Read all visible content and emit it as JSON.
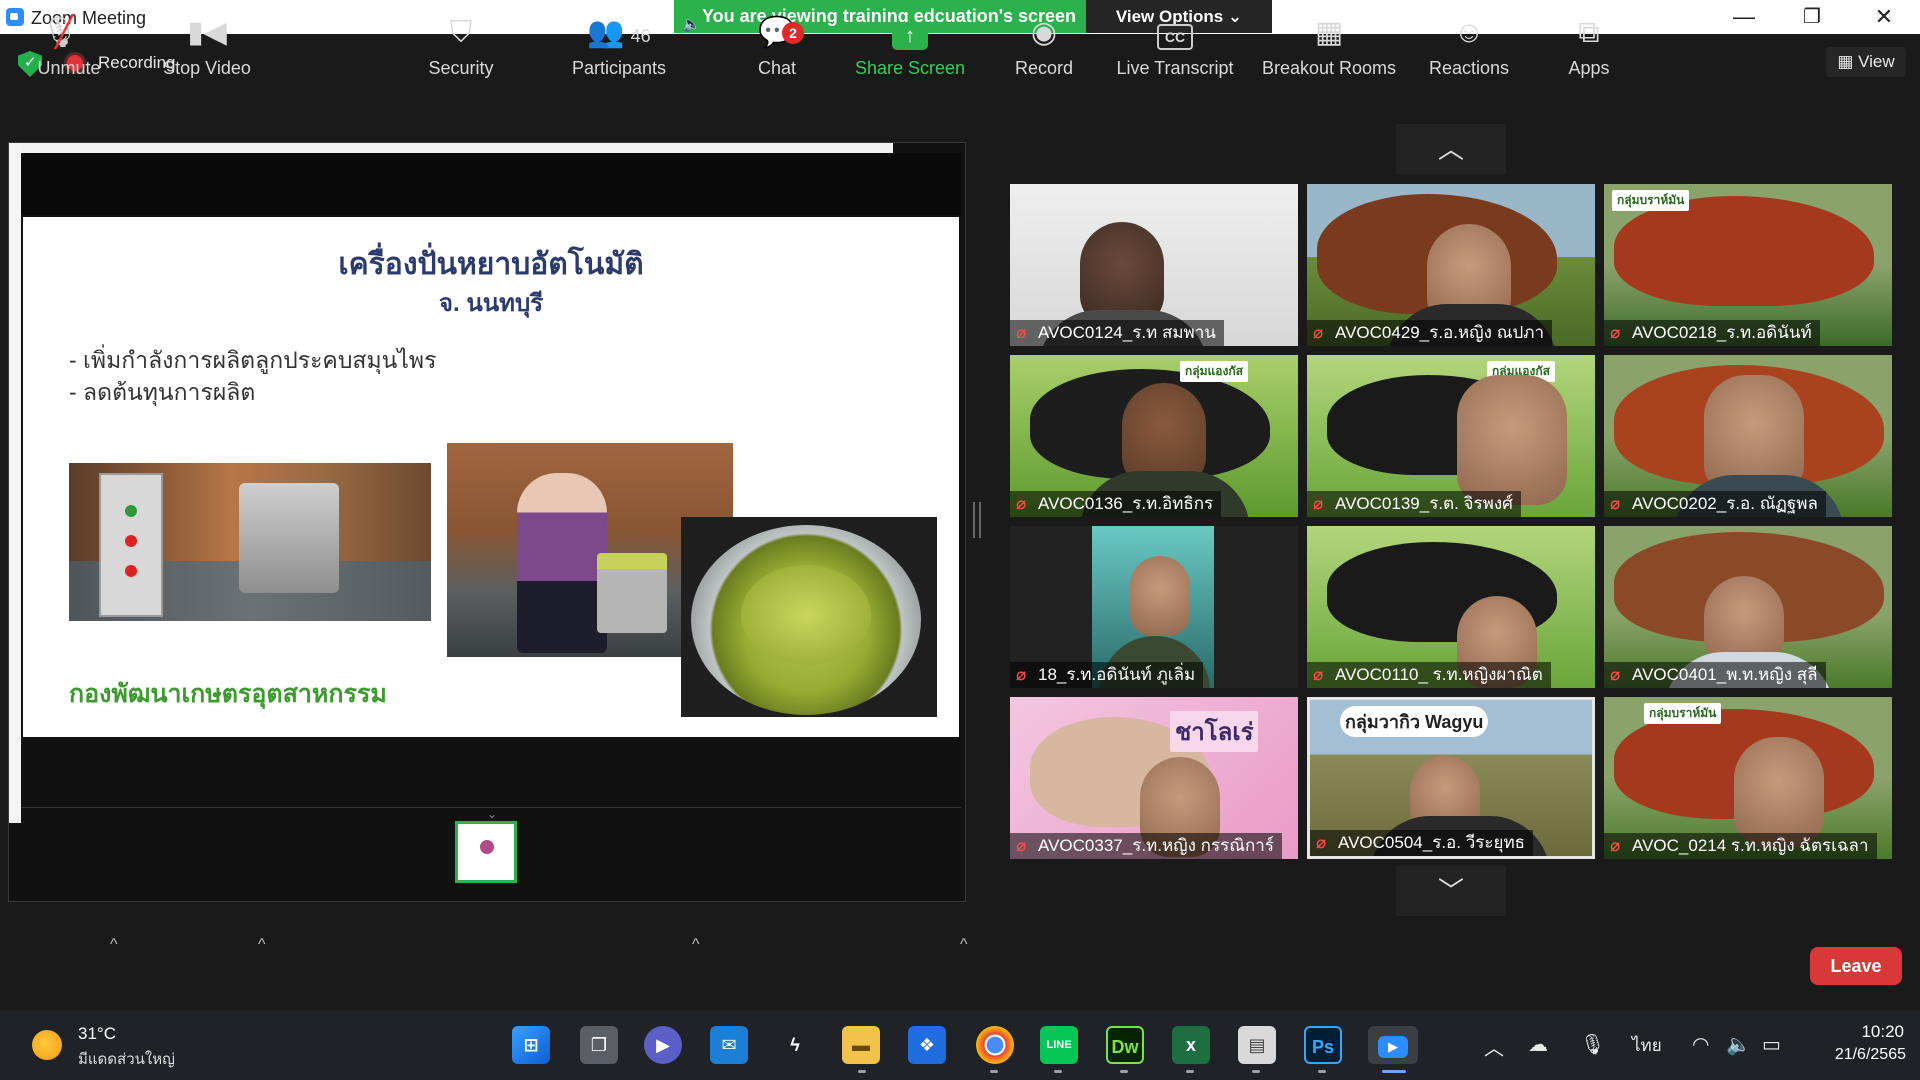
{
  "window": {
    "title": "Zoom Meeting"
  },
  "share_banner": {
    "text": "You are viewing training edcuation's screen",
    "view_options": "View Options ⌄"
  },
  "status": {
    "recording_label": "Recording",
    "view_label": "View"
  },
  "slide": {
    "title": "เครื่องปั่นหยาบอัตโนมัติ",
    "subtitle": "จ. นนทบุรี",
    "bullets": [
      "- เพิ่มกำลังการผลิตลูกประคบสมุนไพร",
      "- ลดต้นทุนการผลิต"
    ],
    "org": "กองพัฒนาเกษตรอุตสาหกรรม"
  },
  "participants": [
    {
      "name": "AVOC0124_ร.ท สมพาน",
      "muted": true
    },
    {
      "name": "AVOC0429_ร.อ.หญิง ณปภา",
      "muted": true
    },
    {
      "name": "AVOC0218_ร.ท.อดินันท์",
      "muted": true
    },
    {
      "name": "AVOC0136_ร.ท.อิทธิกร",
      "muted": true
    },
    {
      "name": "AVOC0139_ร.ต. จิรพงศ์",
      "muted": true
    },
    {
      "name": "AVOC0202_ร.อ. ณัฏฐพล",
      "muted": true
    },
    {
      "name": "18_ร.ท.อดินันท์ ภูเลิ่ม",
      "muted": true
    },
    {
      "name": "AVOC0110_ ร.ท.หญิงผาณิต",
      "muted": true
    },
    {
      "name": "AVOC0401_พ.ท.หญิง สุลี",
      "muted": true
    },
    {
      "name": "AVOC0337_ร.ท.หญิง กรรณิการ์",
      "muted": true
    },
    {
      "name": "AVOC0504_ร.อ. วีระยุทธ",
      "muted": true
    },
    {
      "name": "AVOC_0214 ร.ท.หญิง ฉัตรเฉลา",
      "muted": true
    }
  ],
  "tile_signs": {
    "sign_1": "กลุ่มบราห์มัน",
    "sign_2": "กลุ่มแองกัส",
    "sign_3": "กลุ่มแองกัส",
    "sign_4": "ชาโลเร่",
    "sign_5": "กลุ่มวากิว Wagyu",
    "sign_6": "กลุ่มบราห์มัน"
  },
  "toolbar": {
    "unmute": "Unmute",
    "stop_video": "Stop Video",
    "security": "Security",
    "participants": "Participants",
    "participants_count": "46",
    "chat": "Chat",
    "chat_badge": "2",
    "share_screen": "Share Screen",
    "record": "Record",
    "live_transcript": "Live Transcript",
    "breakout_rooms": "Breakout Rooms",
    "reactions": "Reactions",
    "apps": "Apps",
    "leave": "Leave"
  },
  "taskbar": {
    "weather_temp": "31°C",
    "weather_desc": "มีแดดส่วนใหญ่",
    "lang": "ไทย",
    "time": "10:20",
    "date": "21/6/2565"
  },
  "colors": {
    "share_green": "#2bb24c",
    "leave_red": "#d93838",
    "muted_red": "#ff4a4a"
  }
}
